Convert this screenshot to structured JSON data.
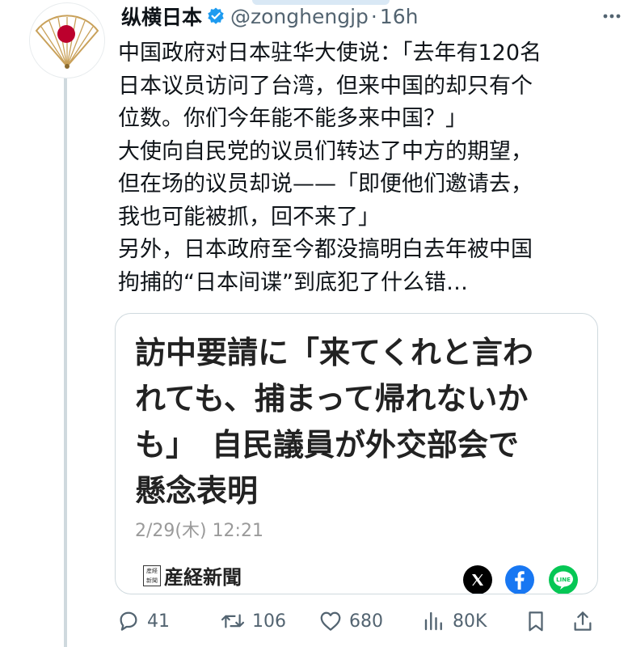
{
  "tweet": {
    "display_name": "纵横日本",
    "handle": "@zonghengjp",
    "separator": "·",
    "time": "16h",
    "text_lines": [
      "中国政府对日本驻华大使说：「去年有120名",
      "日本议员访问了台湾，但来中国的却只有个",
      "位数。你们今年能不能多来中国？」",
      "大使向自民党的议员们转达了中方的期望，",
      "但在场的议员却说——「即便他们邀请去，",
      "我也可能被抓，回不来了」",
      "另外，日本政府至今都没搞明白去年被中国",
      "拘捕的“日本间谍”到底犯了什么错…"
    ]
  },
  "card": {
    "title_lines": [
      "訪中要請に「来てくれと言わ",
      "れても、捕まって帰れないか",
      "も」　自民議員が外交部会で",
      "懸念表明"
    ],
    "date": "2/29(木) 12:21",
    "source_mark": "産経新聞",
    "source_name": "産経新聞",
    "share_icons": [
      "x-logo-icon",
      "facebook-icon",
      "line-icon"
    ],
    "line_label": "LINE"
  },
  "actions": {
    "replies": "41",
    "reposts": "106",
    "likes": "680",
    "views": "80K"
  },
  "colors": {
    "verified": "#1d9bf0",
    "secondary_text": "#536471",
    "border": "#cfd9de",
    "flag_red": "#bc002d",
    "facebook": "#1877f2",
    "line": "#06c755"
  }
}
